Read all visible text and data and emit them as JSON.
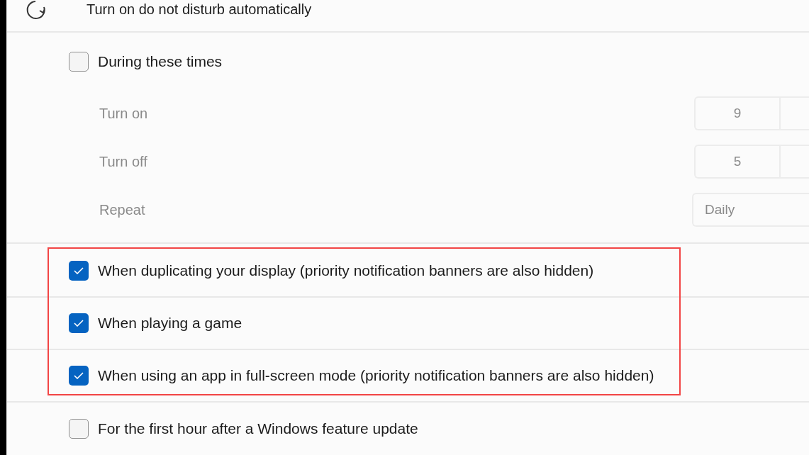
{
  "header": {
    "title": "Turn on do not disturb automatically"
  },
  "schedule": {
    "label": "During these times",
    "checked": false,
    "settings": [
      {
        "kind": "time",
        "label": "Turn on",
        "value": "9"
      },
      {
        "kind": "time",
        "label": "Turn off",
        "value": "5"
      },
      {
        "kind": "dropdown",
        "label": "Repeat",
        "value": "Daily"
      }
    ]
  },
  "rules": [
    {
      "label": "When duplicating your display (priority notification banners are also hidden)",
      "checked": true,
      "highlighted": true
    },
    {
      "label": "When playing a game",
      "checked": true,
      "highlighted": true
    },
    {
      "label": "When using an app in full-screen mode (priority notification banners are also hidden)",
      "checked": true,
      "highlighted": true
    },
    {
      "label": "For the first hour after a Windows feature update",
      "checked": false,
      "highlighted": false
    }
  ]
}
